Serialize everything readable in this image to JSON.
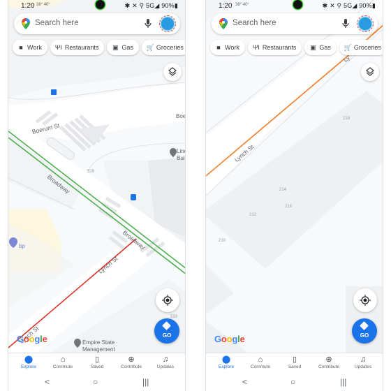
{
  "screens": [
    {
      "status": {
        "time": "1:20",
        "extra": "38° 40°",
        "right": "✱ ✕ ⚲ 5G◢ 90%▮"
      },
      "search": {
        "placeholder": "Search here"
      },
      "chips": [
        {
          "icon": "briefcase-icon",
          "glyph": "■",
          "label": "Work"
        },
        {
          "icon": "restaurant-icon",
          "glyph": "ΨI",
          "label": "Restaurants"
        },
        {
          "icon": "gas-icon",
          "glyph": "▣",
          "label": "Gas"
        },
        {
          "icon": "cart-icon",
          "glyph": "🛒",
          "label": "Groceries"
        }
      ],
      "map_labels": {
        "boerum_st": "Boerum St",
        "boe_partial": "Boe",
        "broadway_1": "Broadway",
        "broadway_2": "Broadway",
        "lynch_1": "Lynch St",
        "lynch_2": "Lynch St",
        "lincoln_l1": "Linc",
        "lincoln_l2": "Buil",
        "bp": "bp",
        "empire_l1": "Empire State",
        "empire_l2": "Management",
        "num_529": "529",
        "num_533": "533"
      },
      "colors": {
        "traffic_green": "#4caf50",
        "traffic_red": "#d93025"
      }
    },
    {
      "status": {
        "time": "1:20",
        "extra": "38° 40°",
        "right": "✱ ✕ ⚲ 5G◢ 90%▮"
      },
      "search": {
        "placeholder": "Search here"
      },
      "chips": [
        {
          "icon": "briefcase-icon",
          "glyph": "■",
          "label": "Work"
        },
        {
          "icon": "restaurant-icon",
          "glyph": "ΨI",
          "label": "Restaurants"
        },
        {
          "icon": "gas-icon",
          "glyph": "▣",
          "label": "Gas"
        },
        {
          "icon": "cart-icon",
          "glyph": "🛒",
          "label": "Groceries"
        }
      ],
      "map_labels": {
        "lynch_1": "Lynch St",
        "lynch_partial": "Ly",
        "num_218": "218",
        "num_214": "214",
        "num_216": "216",
        "num_212": "212",
        "num_210": "210"
      },
      "colors": {
        "traffic_orange": "#f0883a"
      }
    }
  ],
  "go_button": {
    "label": "GO"
  },
  "google_logo": "Google",
  "bottom_nav": [
    {
      "icon": "explore-pin-icon",
      "label": "Explore",
      "active": true
    },
    {
      "icon": "commute-icon",
      "label": "Commute"
    },
    {
      "icon": "bookmark-icon",
      "label": "Saved"
    },
    {
      "icon": "add-circle-icon",
      "label": "Contribute"
    },
    {
      "icon": "bell-icon",
      "label": "Updates"
    }
  ],
  "system_nav": {
    "back": "<",
    "home": "○",
    "recents": "|||"
  }
}
